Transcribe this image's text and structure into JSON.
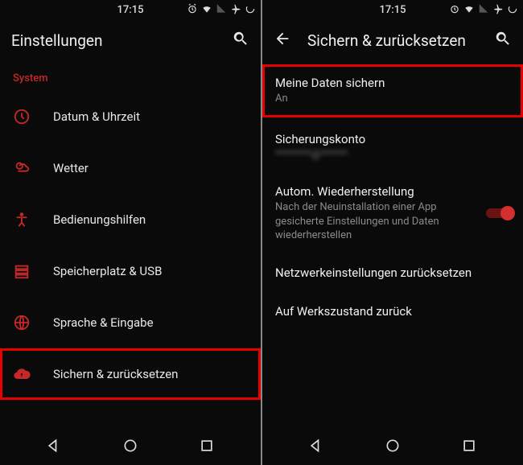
{
  "status": {
    "time": "17:15"
  },
  "left": {
    "title": "Einstellungen",
    "section": "System",
    "items": [
      {
        "label": "Datum & Uhrzeit"
      },
      {
        "label": "Wetter"
      },
      {
        "label": "Bedienungshilfen"
      },
      {
        "label": "Speicherplatz & USB"
      },
      {
        "label": "Sprache & Eingabe"
      },
      {
        "label": "Sichern & zurücksetzen"
      }
    ]
  },
  "right": {
    "title": "Sichern & zurücksetzen",
    "items": [
      {
        "title": "Meine Daten sichern",
        "sub": "An"
      },
      {
        "title": "Sicherungskonto",
        "sub": "********@******"
      },
      {
        "title": "Autom. Wiederherstellung",
        "sub": "Nach der Neuinstallation einer App gesicherte Einstellungen und Daten wiederherstellen"
      },
      {
        "title": "Netzwerkeinstellungen zurücksetzen"
      },
      {
        "title": "Auf Werkszustand zurück"
      }
    ]
  }
}
